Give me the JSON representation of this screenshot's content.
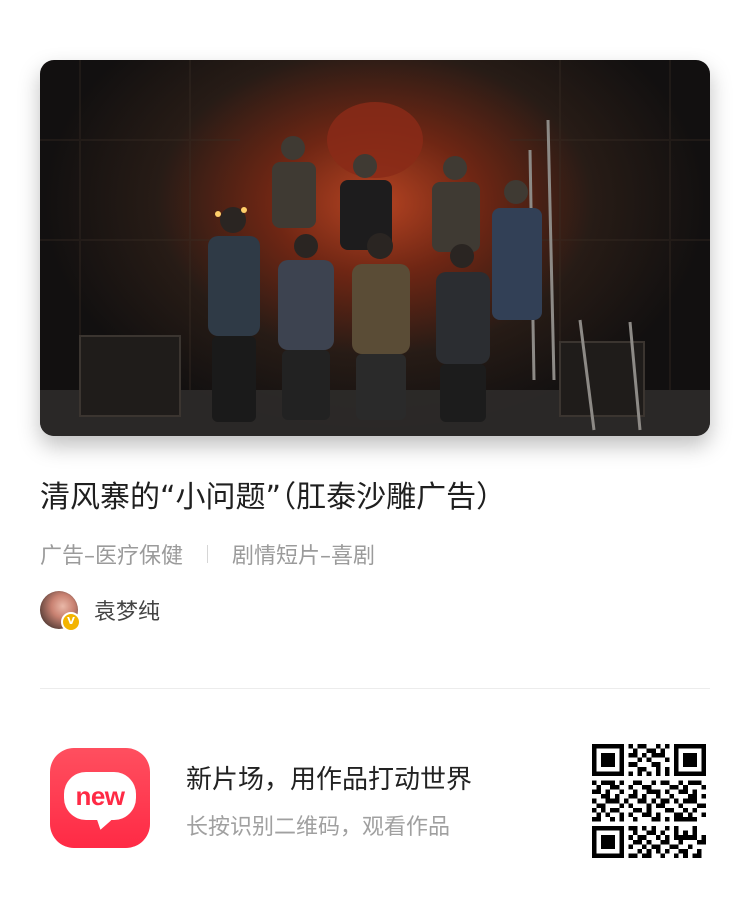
{
  "video": {
    "title": "清风寨的“小问题”（肛泰沙雕广告）",
    "tags": [
      "广告–医疗保健",
      "剧情短片–喜剧"
    ],
    "author": {
      "name": "袁梦纯",
      "verified_badge": "V"
    },
    "cover_image": "group-of-costumed-men-in-bandit-hideout"
  },
  "promo": {
    "app_icon_label": "new",
    "title": "新片场，用作品打动世界",
    "subtitle": "长按识别二维码，观看作品",
    "qr_code": "qr-code"
  },
  "colors": {
    "brand_red": "#ff2a45",
    "verify_yellow": "#f3b400",
    "title_text": "#1f1f1f",
    "muted_text": "#9b9b9b"
  }
}
